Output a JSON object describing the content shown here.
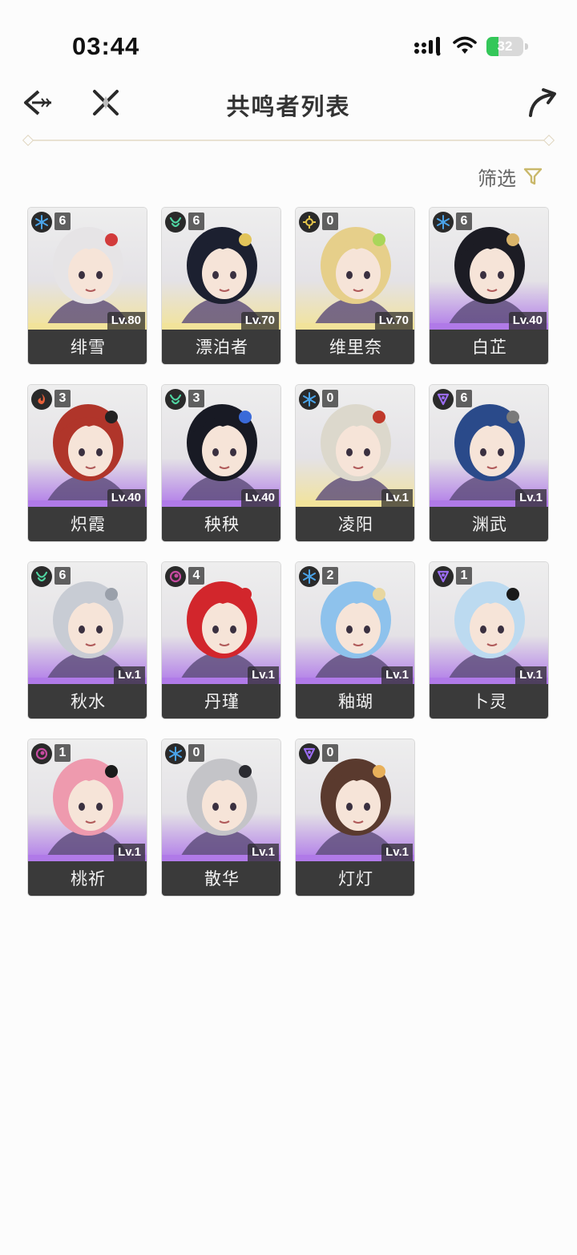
{
  "status_bar": {
    "time": "03:44",
    "battery": "32"
  },
  "header": {
    "title": "共鸣者列表"
  },
  "filter": {
    "label": "筛选"
  },
  "colors": {
    "glacio": "#4aa3e8",
    "aero": "#4fd3a0",
    "spectro": "#e6c64a",
    "fusion": "#e8603a",
    "havoc": "#c64aa0",
    "electro": "#9a6cf0",
    "gold_tier": "#f2e39a",
    "purple_tier": "#b07ae8",
    "accent": "#c9b86a"
  },
  "resonators": [
    {
      "name": "绯雪",
      "level": "Lv.80",
      "sequence": "6",
      "element": "glacio",
      "tier": "gold",
      "hair": "#e6e4e6",
      "ribbon": "#d23b3b"
    },
    {
      "name": "漂泊者",
      "level": "Lv.70",
      "sequence": "6",
      "element": "aero",
      "tier": "gold",
      "hair": "#1c2030",
      "ribbon": "#e2c45a"
    },
    {
      "name": "维里奈",
      "level": "Lv.70",
      "sequence": "0",
      "element": "spectro",
      "tier": "gold",
      "hair": "#e6cf8a",
      "ribbon": "#a9d65a"
    },
    {
      "name": "白芷",
      "level": "Lv.40",
      "sequence": "6",
      "element": "glacio",
      "tier": "purple",
      "hair": "#1c1c24",
      "ribbon": "#d9b46a"
    },
    {
      "name": "炽霞",
      "level": "Lv.40",
      "sequence": "3",
      "element": "fusion",
      "tier": "purple",
      "hair": "#b0352a",
      "ribbon": "#222222"
    },
    {
      "name": "秧秧",
      "level": "Lv.40",
      "sequence": "3",
      "element": "aero",
      "tier": "purple",
      "hair": "#181a24",
      "ribbon": "#3a6ad8"
    },
    {
      "name": "凌阳",
      "level": "Lv.1",
      "sequence": "0",
      "element": "glacio",
      "tier": "gold",
      "hair": "#dcd8cc",
      "ribbon": "#c0392b"
    },
    {
      "name": "渊武",
      "level": "Lv.1",
      "sequence": "6",
      "element": "electro",
      "tier": "purple",
      "hair": "#2a4a8a",
      "ribbon": "#7a7a7a"
    },
    {
      "name": "秋水",
      "level": "Lv.1",
      "sequence": "6",
      "element": "aero",
      "tier": "purple",
      "hair": "#c8ccd4",
      "ribbon": "#9aa0aa"
    },
    {
      "name": "丹瑾",
      "level": "Lv.1",
      "sequence": "4",
      "element": "havoc",
      "tier": "purple",
      "hair": "#d2262c",
      "ribbon": "#d2262c"
    },
    {
      "name": "釉瑚",
      "level": "Lv.1",
      "sequence": "2",
      "element": "glacio",
      "tier": "purple",
      "hair": "#8ec2ec",
      "ribbon": "#e8d7a0"
    },
    {
      "name": "卜灵",
      "level": "Lv.1",
      "sequence": "1",
      "element": "electro",
      "tier": "purple",
      "hair": "#bcdaf0",
      "ribbon": "#1a1a1a"
    },
    {
      "name": "桃祈",
      "level": "Lv.1",
      "sequence": "1",
      "element": "havoc",
      "tier": "purple",
      "hair": "#ee9aae",
      "ribbon": "#1a1a1a"
    },
    {
      "name": "散华",
      "level": "Lv.1",
      "sequence": "0",
      "element": "glacio",
      "tier": "purple",
      "hair": "#c4c4c8",
      "ribbon": "#2a2a30"
    },
    {
      "name": "灯灯",
      "level": "Lv.1",
      "sequence": "0",
      "element": "electro",
      "tier": "purple",
      "hair": "#5a3a2e",
      "ribbon": "#e8b05a"
    }
  ]
}
